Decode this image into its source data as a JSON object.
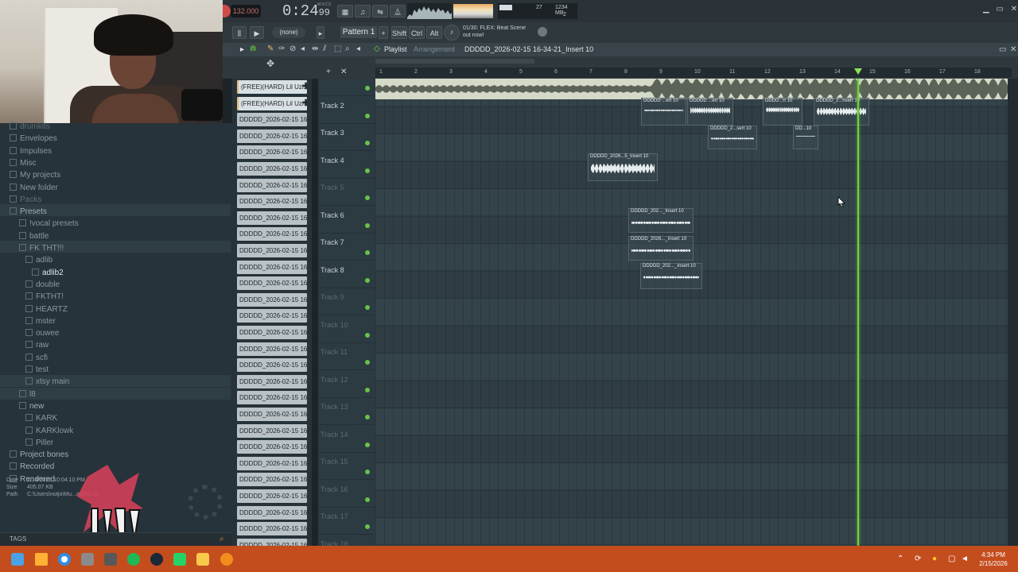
{
  "app": {
    "tempo": "132.000",
    "time": "0:24",
    "time_sub": "99",
    "time_unit": "M:S:CS",
    "cpu": "27",
    "mem": "1234 MB",
    "voices": "2",
    "hint_line1": "01/30: FLEX: Beat Scene",
    "hint_line2": "out now!"
  },
  "toolbar": {
    "none_label": "(none)",
    "pattern_label": "Pattern 1",
    "shift_label": "Shift",
    "ctrl_label": "Ctrl",
    "alt_label": "Alt"
  },
  "playlist": {
    "title": "Playlist",
    "subtitle": "Arrangement",
    "name": "DDDDD_2026-02-15 16-34-21_Insert 10",
    "ruler_ticks": [
      "1",
      "2",
      "3",
      "4",
      "5",
      "6",
      "7",
      "8",
      "9",
      "10",
      "11",
      "12",
      "13",
      "14",
      "15",
      "16",
      "17",
      "18"
    ],
    "tracks": [
      "",
      "Track 2",
      "Track 3",
      "Track 4",
      "Track 5",
      "Track 6",
      "Track 7",
      "Track 8",
      "Track 9",
      "Track 10",
      "Track 11",
      "Track 12",
      "Track 13",
      "Track 14",
      "Track 15",
      "Track 16",
      "Track 17",
      "Track 18"
    ],
    "clips": [
      {
        "label": "DDDDD ...ert 10"
      },
      {
        "label": "DDDDD ...ert 10"
      },
      {
        "label": "DDDD...rt 10"
      },
      {
        "label": "DDDDD_2...nsert 10"
      },
      {
        "label": "DDDDD_2...sert 10"
      },
      {
        "label": "DD...10"
      },
      {
        "label": "DDDDD_2026...5_Insert 10"
      },
      {
        "label": "DDDDD_202..._Insert 10"
      },
      {
        "label": "DDDDD_2026..._Insert 10"
      },
      {
        "label": "DDDDD_202..._Insert 10"
      }
    ]
  },
  "picker": {
    "items": [
      "(FREE)(HARD) Lil Uzi...",
      "(FREE)(HARD) Lil Uzi...",
      "DDDDD_2026-02-15 16-1...",
      "DDDDD_2026-02-15 16-1...",
      "DDDDD_2026-02-15 16-1...",
      "DDDDD_2026-02-15 16-1...",
      "DDDDD_2026-02-15 16-1...",
      "DDDDD_2026-02-15 16-1...",
      "DDDDD_2026-02-15 16-1...",
      "DDDDD_2026-02-15 16-1...",
      "DDDDD_2026-02-15 16-1...",
      "DDDDD_2026-02-15 16-1...",
      "DDDDD_2026-02-15 16-1...",
      "DDDDD_2026-02-15 16-1...",
      "DDDDD_2026-02-15 16-1...",
      "DDDDD_2026-02-15 16-1...",
      "DDDDD_2026-02-15 16-2...",
      "DDDDD_2026-02-15 16-2...",
      "DDDDD_2026-02-15 16-2...",
      "DDDDD_2026-02-15 16-2...",
      "DDDDD_2026-02-15 16-2...",
      "DDDDD_2026-02-15 16-2...",
      "DDDDD_2026-02-15 16-2...",
      "DDDDD_2026-02-15 16-2...",
      "DDDDD_2026-02-15 16-2...",
      "DDDDD_2026-02-15 16-2...",
      "DDDDD_2026-02-15 16-2...",
      "DDDDD_2026-02-15 16-2...",
      "DDDDD_2026-02-15 16-2...",
      "DDDDD_2026-02-15 16-2..."
    ]
  },
  "browser": {
    "items": [
      {
        "label": "drumkits",
        "type": "dim"
      },
      {
        "label": "Envelopes",
        "type": "norm"
      },
      {
        "label": "Impulses",
        "type": "norm"
      },
      {
        "label": "Misc",
        "type": "norm"
      },
      {
        "label": "My projects",
        "type": "norm"
      },
      {
        "label": "New folder",
        "type": "norm"
      },
      {
        "label": "Packs",
        "type": "dim"
      },
      {
        "label": "Presets",
        "type": "head"
      },
      {
        "label": "!vocal presets",
        "type": "norm"
      },
      {
        "label": "battle",
        "type": "norm"
      },
      {
        "label": "FK THT!!!",
        "type": "norm"
      },
      {
        "label": "adlib",
        "type": "norm"
      },
      {
        "label": "adlib2",
        "type": "sel"
      },
      {
        "label": "double",
        "type": "norm"
      },
      {
        "label": "FKTHT!",
        "type": "norm"
      },
      {
        "label": "HEARTZ",
        "type": "norm"
      },
      {
        "label": "mster",
        "type": "norm"
      },
      {
        "label": "ouwee",
        "type": "norm"
      },
      {
        "label": "raw",
        "type": "norm"
      },
      {
        "label": "scfi",
        "type": "norm"
      },
      {
        "label": "test",
        "type": "norm"
      },
      {
        "label": "xtsy main",
        "type": "norm"
      },
      {
        "label": "l8",
        "type": "norm"
      },
      {
        "label": "new",
        "type": "head"
      },
      {
        "label": "KARK",
        "type": "norm"
      },
      {
        "label": "KARKlowk",
        "type": "norm"
      },
      {
        "label": "Piller",
        "type": "norm"
      },
      {
        "label": "Project bones",
        "type": "head"
      },
      {
        "label": "Recorded",
        "type": "head"
      },
      {
        "label": "Rendered",
        "type": "head"
      }
    ],
    "info_date_label": "Date",
    "info_date": "2/14/2026 10:04:10 PM",
    "info_size_label": "Size",
    "info_size": "405.07 KB",
    "info_path_label": "Path",
    "info_path": "C:\\Users\\notjo\\Mu...adlib2.fst",
    "tags": "TAGS"
  },
  "taskbar": {
    "time": "4:34 PM",
    "date": "2/15/2026"
  },
  "colors": {
    "playhead": "#6ed33f",
    "taskbar": "#c44d1e",
    "accent": "#e8ba74"
  }
}
